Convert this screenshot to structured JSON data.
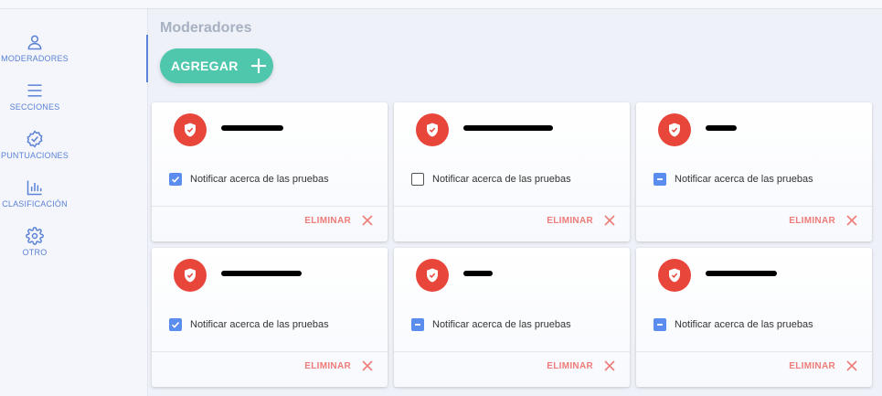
{
  "sidebar": {
    "items": [
      {
        "label": "MODERADORES",
        "icon": "person-icon",
        "active": true
      },
      {
        "label": "SECCIONES",
        "icon": "menu-lines-icon",
        "active": false
      },
      {
        "label": "PUNTUACIONES",
        "icon": "check-badge-icon",
        "active": false
      },
      {
        "label": "CLASIFICACIÓN",
        "icon": "bar-chart-icon",
        "active": false
      },
      {
        "label": "OTRO",
        "icon": "gear-icon",
        "active": false
      }
    ],
    "accent_color": "#5b82d6"
  },
  "main": {
    "title": "Moderadores",
    "add_button_label": "AGREGAR",
    "cards": [
      {
        "notify_label": "Notificar acerca de las pruebas",
        "checkbox": "checked",
        "delete_label": "ELIMINAR"
      },
      {
        "notify_label": "Notificar acerca de las pruebas",
        "checkbox": "unchecked",
        "delete_label": "ELIMINAR"
      },
      {
        "notify_label": "Notificar acerca de las pruebas",
        "checkbox": "partial",
        "delete_label": "ELIMINAR"
      },
      {
        "notify_label": "Notificar acerca de las pruebas",
        "checkbox": "checked",
        "delete_label": "ELIMINAR"
      },
      {
        "notify_label": "Notificar acerca de las pruebas",
        "checkbox": "partial",
        "delete_label": "ELIMINAR"
      },
      {
        "notify_label": "Notificar acerca de las pruebas",
        "checkbox": "partial",
        "delete_label": "ELIMINAR"
      }
    ]
  },
  "colors": {
    "add_button": "#4fc7ad",
    "avatar": "#e8463a",
    "delete": "#ee7c78",
    "checkbox": "#5b8def"
  }
}
